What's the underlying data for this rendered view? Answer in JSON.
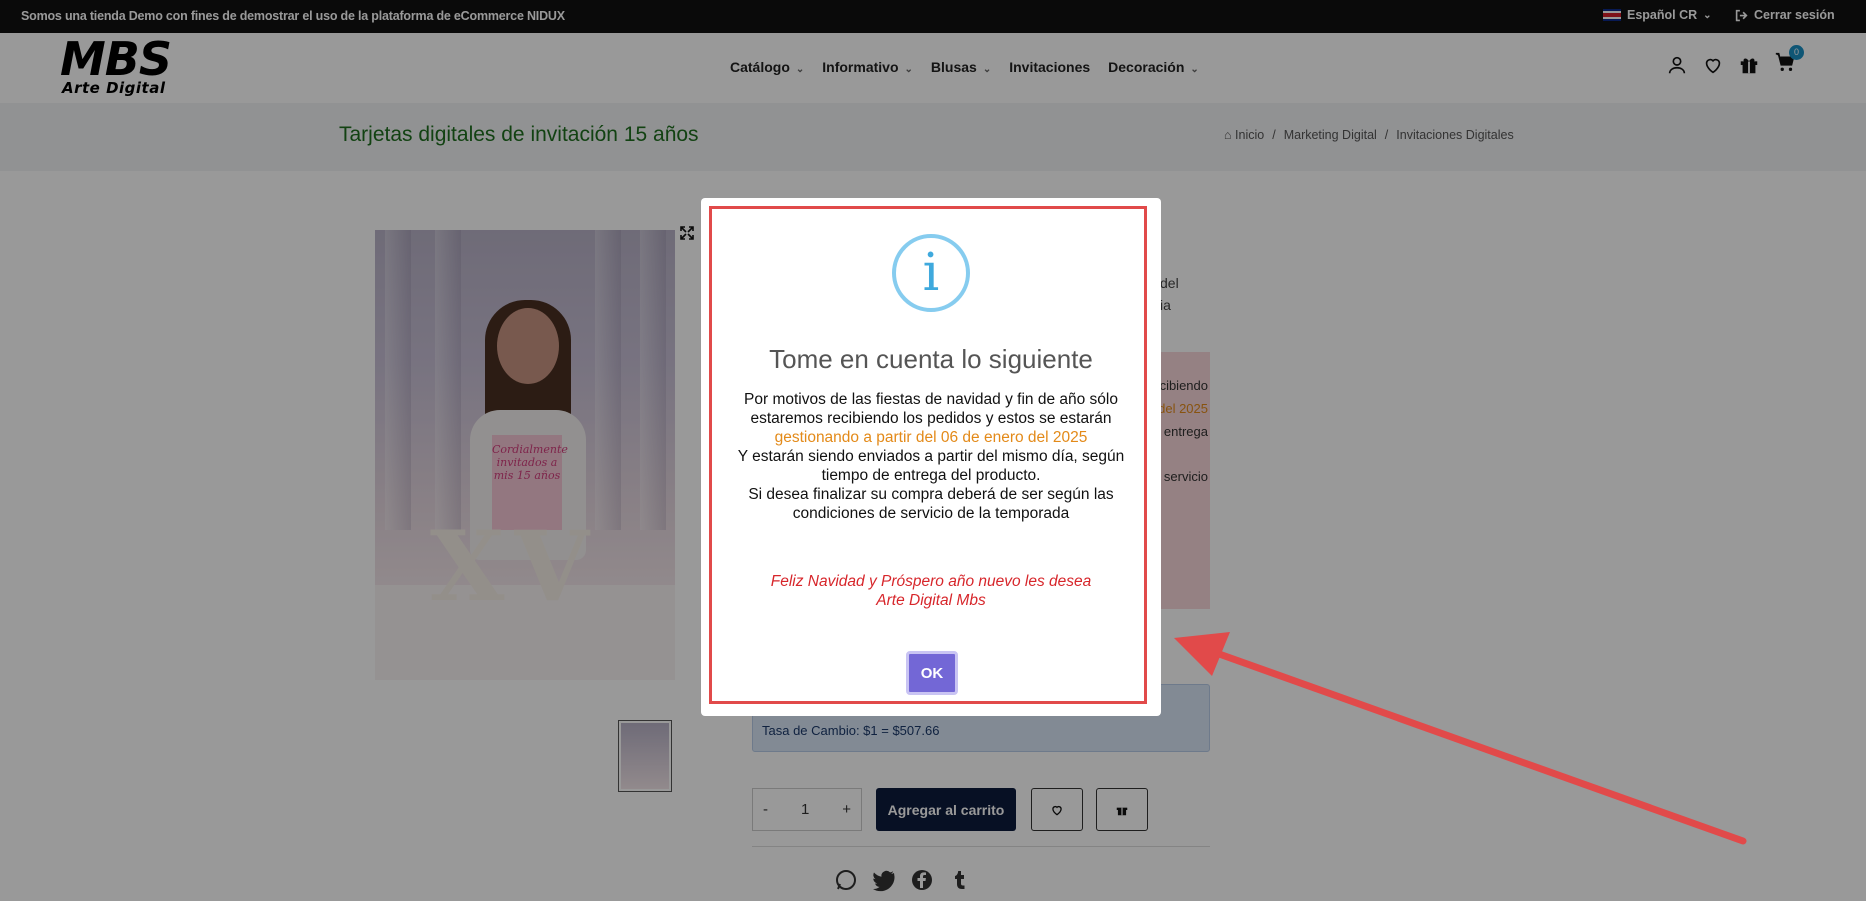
{
  "topbar": {
    "promo": "Somos una tienda Demo con fines de demostrar el uso de la plataforma de eCommerce NIDUX",
    "language": "Español CR",
    "logout": "Cerrar sesión"
  },
  "logo": {
    "line1": "MBS",
    "line2": "Arte Digital"
  },
  "nav": {
    "items": [
      {
        "label": "Catálogo",
        "has_dropdown": true
      },
      {
        "label": "Informativo",
        "has_dropdown": true
      },
      {
        "label": "Blusas",
        "has_dropdown": true
      },
      {
        "label": "Invitaciones",
        "has_dropdown": false
      },
      {
        "label": "Decoración",
        "has_dropdown": true
      }
    ]
  },
  "header_icons": [
    "user-icon",
    "heart-icon",
    "gift-icon",
    "cart-icon"
  ],
  "cart_count": "0",
  "page": {
    "title": "Tarjetas digitales de invitación 15 años",
    "breadcrumb": [
      "Inicio",
      "Marketing Digital",
      "Invitaciones Digitales"
    ]
  },
  "product": {
    "image_sign_text": "Cordialmente invitados a mis 15 años",
    "image_letters": "XV",
    "desc_fragment": [
      "del",
      "ia"
    ],
    "notice_fragments": [
      "cibiendo",
      "del 2025",
      "entrega",
      "servicio"
    ],
    "exchange_rate": "Tasa de Cambio: $1 = $507.66",
    "quantity": "1",
    "qty_minus": "-",
    "qty_plus": "+",
    "add_to_cart": "Agregar al carrito",
    "share_icons": [
      "whatsapp-icon",
      "twitter-icon",
      "facebook-icon",
      "tumblr-icon"
    ]
  },
  "modal": {
    "title": "Tome en cuenta lo siguiente",
    "body_line1": "Por motivos de las fiestas de navidad y fin de año sólo estaremos recibiendo los pedidos y estos se estarán",
    "body_highlight": "gestionando a partir del 06 de enero del 2025",
    "body_line2": "Y estarán siendo enviados a partir del mismo día, según tiempo de entrega del producto.",
    "body_line3": "Si desea finalizar su compra deberá de ser según las condiciones de servicio de la temporada",
    "greeting_line1": "Feliz Navidad y Próspero año nuevo les desea",
    "greeting_line2": "Arte Digital Mbs",
    "ok_label": "OK"
  },
  "colors": {
    "title_green": "#1f6f1f",
    "highlight_orange": "#e38a19",
    "greeting_red": "#d7262b",
    "ok_purple": "#7367d6",
    "annotation_red": "#e14a4a"
  }
}
